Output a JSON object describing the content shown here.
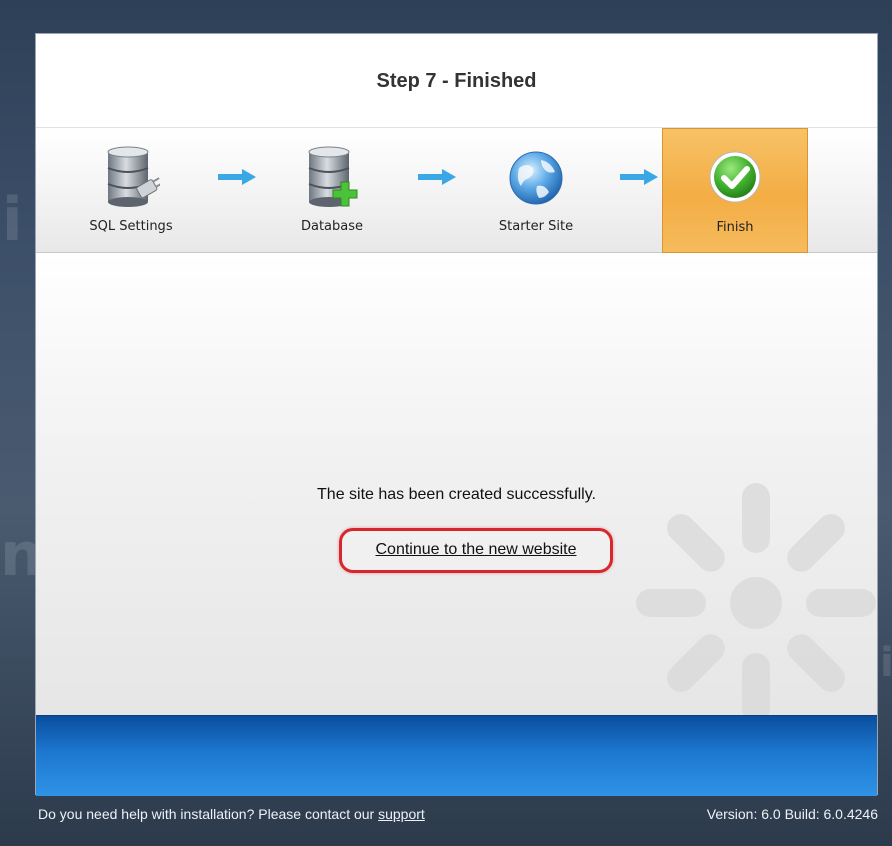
{
  "wizard": {
    "title": "Step 7 - Finished"
  },
  "steps": [
    {
      "label": "SQL Settings",
      "icon": "database-plug-icon",
      "active": false
    },
    {
      "label": "Database",
      "icon": "database-add-icon",
      "active": false
    },
    {
      "label": "Starter Site",
      "icon": "globe-icon",
      "active": false
    },
    {
      "label": "Finish",
      "icon": "green-check-icon",
      "active": true
    }
  ],
  "content": {
    "message": "The site has been created successfully.",
    "continue_link": "Continue to the new website"
  },
  "footer": {
    "help_text": "Do you need help with installation? Please contact our ",
    "support_link": "support",
    "version": "Version: 6.0 Build: 6.0.4246"
  },
  "colors": {
    "active_step": "#f3ad44",
    "bottom_bar": "#1c78cf",
    "highlight_ring": "#d9262d",
    "arrow": "#3aa7e6"
  }
}
